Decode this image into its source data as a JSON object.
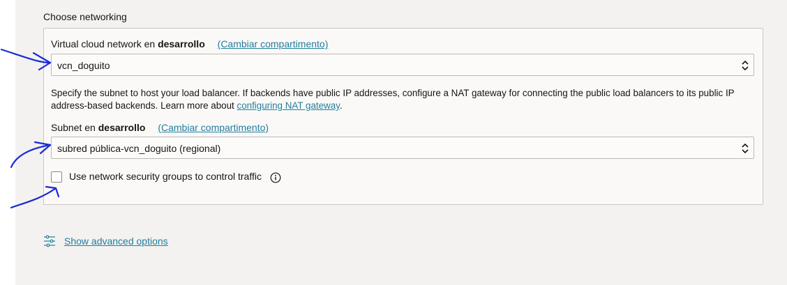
{
  "section": {
    "title": "Choose networking"
  },
  "vcn": {
    "label_prefix": "Virtual cloud network en",
    "compartment": "desarrollo",
    "change_link": "(Cambiar compartimento)",
    "selected": "vcn_doguito"
  },
  "help": {
    "text": "Specify the subnet to host your load balancer. If backends have public IP addresses, configure a NAT gateway for connecting the public load balancers to its public IP address-based backends. Learn more about ",
    "link": "configuring NAT gateway",
    "suffix": "."
  },
  "subnet": {
    "label_prefix": "Subnet en",
    "compartment": "desarrollo",
    "change_link": "(Cambiar compartimento)",
    "selected": "subred pública-vcn_doguito (regional)"
  },
  "nsg": {
    "label": "Use network security groups to control traffic",
    "checked": false
  },
  "advanced": {
    "label": "Show advanced options"
  },
  "colors": {
    "link": "#227e9e",
    "annotation": "#1a2bd6"
  },
  "icons": [
    "chevron-updown-icon",
    "info-icon",
    "sliders-icon"
  ]
}
